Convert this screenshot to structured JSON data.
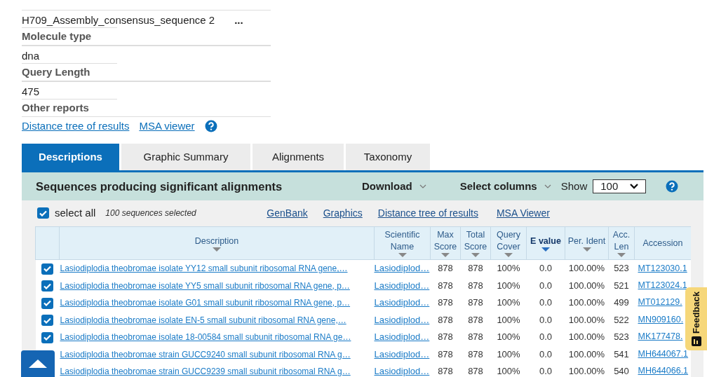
{
  "query_info": {
    "items": [
      {
        "kind": "value",
        "text": "H709_Assembly_consensus_sequence 2",
        "more": "..."
      },
      {
        "kind": "label",
        "text": "Molecule type"
      },
      {
        "kind": "value",
        "text": "dna"
      },
      {
        "kind": "label",
        "text": "Query Length"
      },
      {
        "kind": "value",
        "text": "475"
      },
      {
        "kind": "label",
        "text": "Other reports"
      }
    ],
    "links": [
      "Distance tree of results",
      "MSA viewer"
    ]
  },
  "tabs": [
    {
      "label": "Descriptions",
      "selected": true
    },
    {
      "label": "Graphic Summary",
      "selected": false
    },
    {
      "label": "Alignments",
      "selected": false
    },
    {
      "label": "Taxonomy",
      "selected": false
    }
  ],
  "results": {
    "title": "Sequences producing significant alignments",
    "download": "Download",
    "select_columns": "Select columns",
    "show_label": "Show",
    "show_value": "100",
    "select_all": {
      "label": "select all",
      "checked": true
    },
    "selected_count": "100 sequences selected",
    "links": [
      "GenBank",
      "Graphics",
      "Distance tree of results",
      "MSA Viewer"
    ]
  },
  "table": {
    "columns": [
      {
        "label": "Description",
        "sorted": false
      },
      {
        "label": "Scientific Name",
        "sorted": false
      },
      {
        "label": "Max Score",
        "sorted": false
      },
      {
        "label": "Total Score",
        "sorted": false
      },
      {
        "label": "Query Cover",
        "sorted": false
      },
      {
        "label": "E value",
        "sorted": true
      },
      {
        "label": "Per. Ident",
        "sorted": false
      },
      {
        "label": "Acc. Len",
        "sorted": false
      },
      {
        "label": "Accession"
      }
    ],
    "rows": [
      {
        "checked": true,
        "cells": [
          "Lasiodiplodia theobromae isolate YY12 small subunit ribosomal RNA gene,…",
          "Lasiodiplod…",
          "878",
          "878",
          "100%",
          "0.0",
          "100.00%",
          "523",
          "MT123030.1"
        ]
      },
      {
        "checked": true,
        "cells": [
          "Lasiodiplodia theobromae isolate YY5 small subunit ribosomal RNA gene, p…",
          "Lasiodiplod…",
          "878",
          "878",
          "100%",
          "0.0",
          "100.00%",
          "521",
          "MT123024.1"
        ]
      },
      {
        "checked": true,
        "cells": [
          "Lasiodiplodia theobromae isolate G01 small subunit ribosomal RNA gene, p…",
          "Lasiodiplod…",
          "878",
          "878",
          "100%",
          "0.0",
          "100.00%",
          "499",
          "MT012129."
        ]
      },
      {
        "checked": true,
        "cells": [
          "Lasiodiplodia theobromae isolate EN-5 small subunit ribosomal RNA gene,…",
          "Lasiodiplod…",
          "878",
          "878",
          "100%",
          "0.0",
          "100.00%",
          "522",
          "MN909160."
        ]
      },
      {
        "checked": true,
        "cells": [
          "Lasiodiplodia theobromae isolate 18-00584 small subunit ribosomal RNA ge…",
          "Lasiodiplod…",
          "878",
          "878",
          "100%",
          "0.0",
          "100.00%",
          "523",
          "MK177478."
        ]
      },
      {
        "cells": [
          "Lasiodiplodia theobromae strain GUCC9240 small subunit ribosomal RNA g…",
          "Lasiodiplod…",
          "878",
          "878",
          "100%",
          "0.0",
          "100.00%",
          "541",
          "MH644067.1"
        ]
      },
      {
        "cells": [
          "Lasiodiplodia theobromae strain GUCC9239 small subunit ribosomal RNA g…",
          "Lasiodiplod…",
          "878",
          "878",
          "100%",
          "0.0",
          "100.00%",
          "540",
          "MH644066.1"
        ]
      }
    ]
  },
  "feedback": "Feedback"
}
